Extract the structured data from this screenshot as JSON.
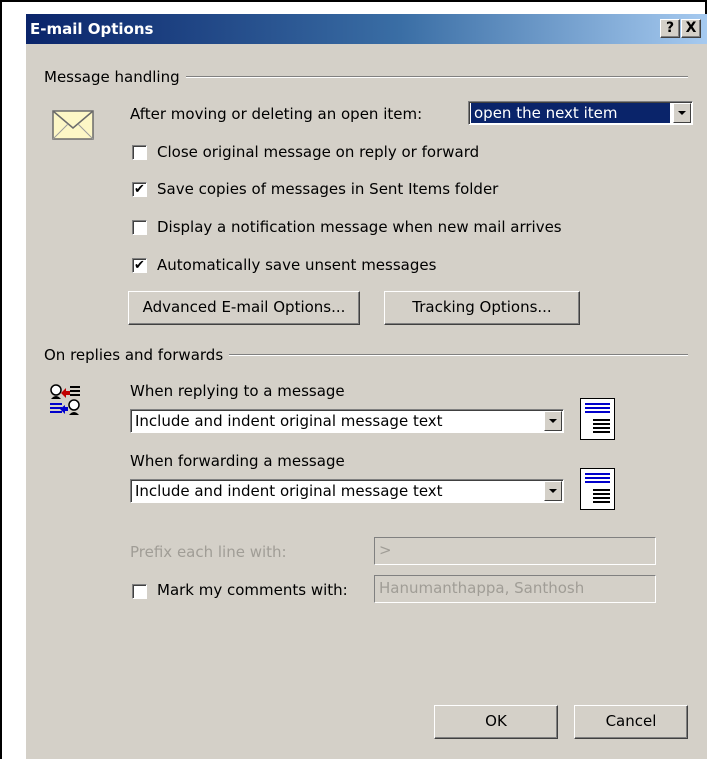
{
  "dialog": {
    "title": "E-mail Options",
    "help_button": "?",
    "close_button": "X"
  },
  "message_handling": {
    "group_label": "Message handling",
    "after_moving_label": "After moving or deleting an open item:",
    "after_moving_value": "open the next item",
    "checkboxes": [
      {
        "label": "Close original message on reply or forward",
        "checked": false
      },
      {
        "label": "Save copies of messages in Sent Items folder",
        "checked": true
      },
      {
        "label": "Display a notification message when new mail arrives",
        "checked": false
      },
      {
        "label": "Automatically save unsent messages",
        "checked": true
      }
    ],
    "advanced_button": "Advanced E-mail Options...",
    "tracking_button": "Tracking Options..."
  },
  "replies": {
    "group_label": "On replies and forwards",
    "replying_label": "When replying to a message",
    "replying_value": "Include and indent original message text",
    "forwarding_label": "When forwarding a message",
    "forwarding_value": "Include and indent original message text",
    "prefix_label": "Prefix each line with:",
    "prefix_value": ">",
    "mark_label": "Mark my comments with:",
    "mark_checked": false,
    "mark_value": "Hanumanthappa, Santhosh"
  },
  "footer": {
    "ok_button": "OK",
    "cancel_button": "Cancel"
  },
  "colors": {
    "dialog_face": "#d4d0c8",
    "title_active": "#0a246a",
    "selection": "#0a246a",
    "preview_blue": "#0000cc"
  },
  "icons": {
    "envelope": "envelope-icon",
    "reply_forward": "reply-forward-people-icon",
    "dropdown": "chevron-down-icon"
  }
}
